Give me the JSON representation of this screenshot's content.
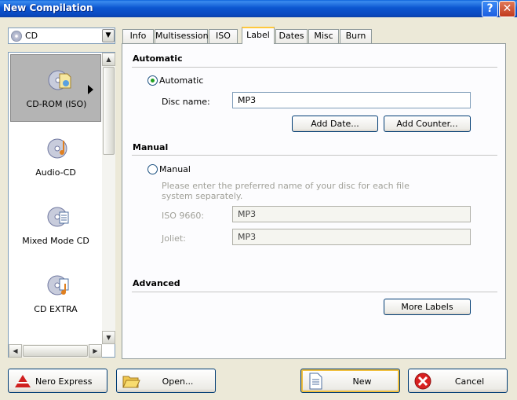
{
  "window": {
    "title": "New Compilation",
    "help_glyph": "?",
    "close_glyph": "✕"
  },
  "disc_type": {
    "selected": "CD"
  },
  "compilations": [
    {
      "label": "CD-ROM (ISO)",
      "icon": "cd-rom-iso-icon",
      "selected": true
    },
    {
      "label": "Audio-CD",
      "icon": "audio-cd-icon",
      "selected": false
    },
    {
      "label": "Mixed Mode CD",
      "icon": "mixed-mode-cd-icon",
      "selected": false
    },
    {
      "label": "CD EXTRA",
      "icon": "cd-extra-icon",
      "selected": false
    }
  ],
  "tabs": [
    {
      "label": "Info"
    },
    {
      "label": "Multisession"
    },
    {
      "label": "ISO"
    },
    {
      "label": "Label",
      "active": true
    },
    {
      "label": "Dates"
    },
    {
      "label": "Misc"
    },
    {
      "label": "Burn"
    }
  ],
  "label_tab": {
    "automatic": {
      "section_title": "Automatic",
      "radio_label": "Automatic",
      "checked": true,
      "disc_name_label": "Disc name:",
      "disc_name_value": "MP3",
      "add_date_button": "Add Date...",
      "add_counter_button": "Add Counter..."
    },
    "manual": {
      "section_title": "Manual",
      "radio_label": "Manual",
      "checked": false,
      "hint": "Please enter the preferred name of your disc for each file system separately.",
      "iso_label": "ISO 9660:",
      "iso_value": "MP3",
      "joliet_label": "Joliet:",
      "joliet_value": "MP3"
    },
    "advanced": {
      "section_title": "Advanced",
      "more_labels_button": "More Labels"
    }
  },
  "footer": {
    "nero_express": "Nero Express",
    "open": "Open...",
    "new": "New",
    "cancel": "Cancel"
  },
  "colors": {
    "titlebar": "#0a49c0",
    "panel": "#fcfcfe",
    "dialog": "#ece9d8",
    "radio_dot": "#21a121"
  }
}
